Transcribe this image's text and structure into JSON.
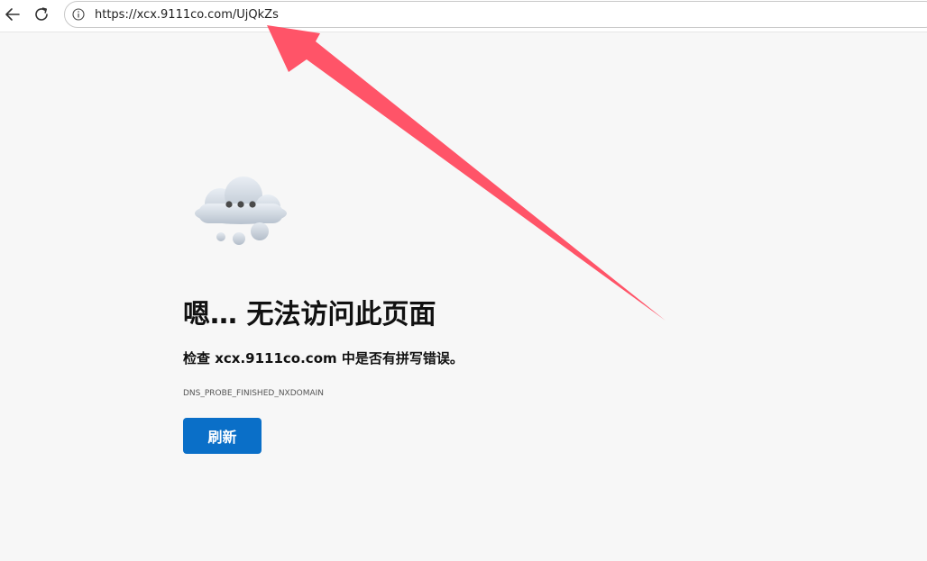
{
  "browser": {
    "url": "https://xcx.9111co.com/UjQkZs",
    "icons": {
      "back": "back-arrow-icon",
      "refresh": "refresh-icon",
      "site_info": "info-icon"
    }
  },
  "error_page": {
    "title": "嗯… 无法访问此页面",
    "description": "检查 xcx.9111co.com 中是否有拼写错误。",
    "error_code": "DNS_PROBE_FINISHED_NXDOMAIN",
    "refresh_label": "刷新",
    "illustration": "cloud-error-icon"
  },
  "colors": {
    "page_background": "#f7f7f7",
    "button": "#0a6fc8",
    "annotation_arrow": "#ff5468"
  }
}
